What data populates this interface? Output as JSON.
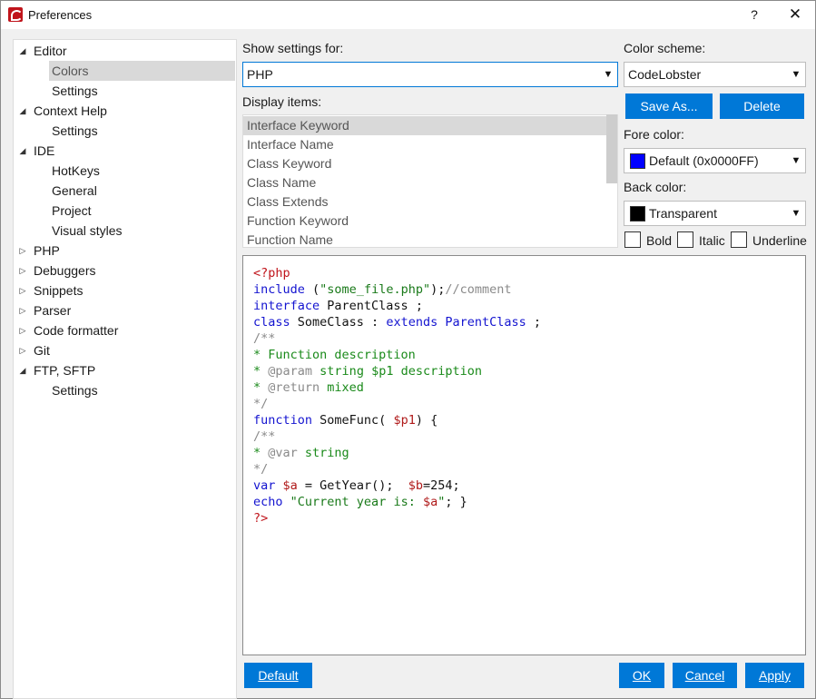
{
  "window": {
    "title": "Preferences",
    "help_label": "?",
    "close_label": "✕"
  },
  "tree": [
    {
      "label": "Editor",
      "expander": "expanded"
    },
    {
      "label": "Colors",
      "selected": true
    },
    {
      "label": "Settings"
    },
    {
      "label": "Context Help",
      "expander": "expanded"
    },
    {
      "label": "Settings"
    },
    {
      "label": "IDE",
      "expander": "expanded"
    },
    {
      "label": "HotKeys"
    },
    {
      "label": "General"
    },
    {
      "label": "Project"
    },
    {
      "label": "Visual styles"
    },
    {
      "label": "PHP",
      "expander": "collapsed"
    },
    {
      "label": "Debuggers",
      "expander": "collapsed"
    },
    {
      "label": "Snippets",
      "expander": "collapsed"
    },
    {
      "label": "Parser",
      "expander": "collapsed"
    },
    {
      "label": "Code formatter",
      "expander": "collapsed"
    },
    {
      "label": "Git",
      "expander": "collapsed"
    },
    {
      "label": "FTP, SFTP",
      "expander": "expanded"
    },
    {
      "label": "Settings"
    }
  ],
  "settings": {
    "show_for_label": "Show settings for:",
    "show_for_value": "PHP",
    "display_items_label": "Display items:",
    "display_items": [
      "Interface Keyword",
      "Interface Name",
      "Class Keyword",
      "Class Name",
      "Class Extends",
      "Function Keyword",
      "Function Name"
    ],
    "selected_item": "Interface Keyword"
  },
  "scheme": {
    "label": "Color scheme:",
    "value": "CodeLobster",
    "save_as_label": "Save As...",
    "delete_label": "Delete",
    "fore_label": "Fore color:",
    "fore_value": "Default (0x0000FF)",
    "fore_swatch": "#0000ff",
    "back_label": "Back color:",
    "back_value": "Transparent",
    "back_swatch": "#000000",
    "bold_label": "Bold",
    "italic_label": "Italic",
    "underline_label": "Underline"
  },
  "code_preview": [
    [
      {
        "t": "<?php",
        "c": "tag"
      }
    ],
    [
      {
        "t": "include",
        "c": "kw"
      },
      {
        "t": " (",
        "c": "plain"
      },
      {
        "t": "\"some_file.php\"",
        "c": "str"
      },
      {
        "t": ");",
        "c": "plain"
      },
      {
        "t": "//comment",
        "c": "cmt"
      }
    ],
    [
      {
        "t": "interface",
        "c": "kw"
      },
      {
        "t": " ParentClass ;",
        "c": "plain"
      }
    ],
    [
      {
        "t": "class",
        "c": "kw"
      },
      {
        "t": " SomeClass : ",
        "c": "plain"
      },
      {
        "t": "extends ParentClass",
        "c": "kw"
      },
      {
        "t": " ;",
        "c": "plain"
      }
    ],
    [
      {
        "t": "/**",
        "c": "cmt"
      }
    ],
    [
      {
        "t": "* Function description",
        "c": "doc"
      }
    ],
    [
      {
        "t": "* ",
        "c": "doc"
      },
      {
        "t": "@param",
        "c": "doctag"
      },
      {
        "t": " string $p1 description",
        "c": "doc"
      }
    ],
    [
      {
        "t": "* ",
        "c": "doc"
      },
      {
        "t": "@return",
        "c": "doctag"
      },
      {
        "t": " mixed",
        "c": "doc"
      }
    ],
    [
      {
        "t": "*/",
        "c": "cmt"
      }
    ],
    [
      {
        "t": "function",
        "c": "kw"
      },
      {
        "t": " SomeFunc( ",
        "c": "plain"
      },
      {
        "t": "$p1",
        "c": "var"
      },
      {
        "t": ") {",
        "c": "plain"
      }
    ],
    [
      {
        "t": "/**",
        "c": "cmt"
      }
    ],
    [
      {
        "t": "* ",
        "c": "doc"
      },
      {
        "t": "@var",
        "c": "doctag"
      },
      {
        "t": " string",
        "c": "doc"
      }
    ],
    [
      {
        "t": "*/",
        "c": "cmt"
      }
    ],
    [
      {
        "t": "var",
        "c": "kw"
      },
      {
        "t": " ",
        "c": "plain"
      },
      {
        "t": "$a",
        "c": "var"
      },
      {
        "t": " = GetYear();  ",
        "c": "plain"
      },
      {
        "t": "$b",
        "c": "var"
      },
      {
        "t": "=254;",
        "c": "plain"
      }
    ],
    [
      {
        "t": "echo",
        "c": "kw"
      },
      {
        "t": " ",
        "c": "plain"
      },
      {
        "t": "\"Current year is: ",
        "c": "str"
      },
      {
        "t": "$a",
        "c": "var"
      },
      {
        "t": "\"",
        "c": "str"
      },
      {
        "t": "; }",
        "c": "plain"
      }
    ],
    [
      {
        "t": "?>",
        "c": "tag"
      }
    ]
  ],
  "footer": {
    "default_label": "Default",
    "ok_label": "OK",
    "cancel_label": "Cancel",
    "apply_label": "Apply"
  },
  "colors": {
    "accent": "#0078d7",
    "selection": "#d9d9d9"
  }
}
